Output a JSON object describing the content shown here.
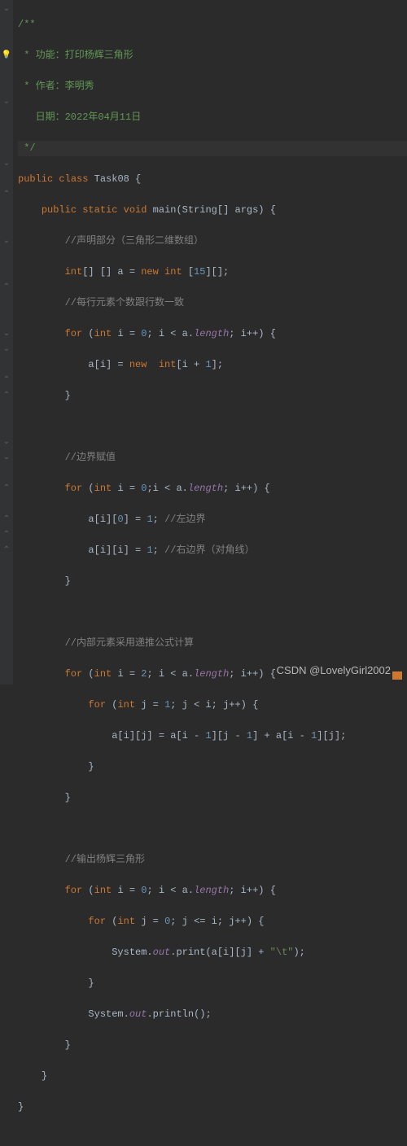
{
  "gutter": {
    "fold_down": "⌄",
    "fold_up": "⌃",
    "bulb": "💡",
    "close_brace": "⌃"
  },
  "code": {
    "l1": "/**",
    "l2_a": " * 功能：打印杨辉三角形",
    "l3_a": " * 作者：李明秀",
    "l4_a": "   日期：2022年04月11日",
    "l5": " */",
    "l6_kw1": "public",
    "l6_kw2": "class",
    "l6_name": " Task08 {",
    "l7_kw1": "public",
    "l7_kw2": "static",
    "l7_kw3": "void",
    "l7_name": " main(String[] args) {",
    "l8": "//声明部分（三角形二维数组）",
    "l9_kw1": "int",
    "l9_a": "[] [] a = ",
    "l9_kw2": "new int ",
    "l9_b": "[",
    "l9_n": "15",
    "l9_c": "][];",
    "l10": "//每行元素个数跟行数一致",
    "l11_kw1": "for ",
    "l11_a": "(",
    "l11_kw2": "int ",
    "l11_b": "i = ",
    "l11_n1": "0",
    "l11_c": "; i < a.",
    "l11_f": "length",
    "l11_d": "; i++) {",
    "l12_a": "a[i] = ",
    "l12_kw": "new  int",
    "l12_b": "[i + ",
    "l12_n": "1",
    "l12_c": "];",
    "l13": "}",
    "l15": "//边界赋值",
    "l16_kw1": "for ",
    "l16_a": "(",
    "l16_kw2": "int ",
    "l16_b": "i = ",
    "l16_n1": "0",
    "l16_c": ";i < a.",
    "l16_f": "length",
    "l16_d": "; i++) {",
    "l17_a": "a[i][",
    "l17_n1": "0",
    "l17_b": "] = ",
    "l17_n2": "1",
    "l17_c": "; ",
    "l17_cm": "//左边界",
    "l18_a": "a[i][i] = ",
    "l18_n": "1",
    "l18_b": "; ",
    "l18_cm": "//右边界（对角线）",
    "l19": "}",
    "l21": "//内部元素采用递推公式计算",
    "l22_kw1": "for ",
    "l22_a": "(",
    "l22_kw2": "int ",
    "l22_b": "i = ",
    "l22_n1": "2",
    "l22_c": "; i < a.",
    "l22_f": "length",
    "l22_d": "; i++) {",
    "l23_kw1": "for ",
    "l23_a": "(",
    "l23_kw2": "int ",
    "l23_b": "j = ",
    "l23_n1": "1",
    "l23_c": "; j < i; j++) {",
    "l24_a": "a[i][j] = a[i - ",
    "l24_n1": "1",
    "l24_b": "][j - ",
    "l24_n2": "1",
    "l24_c": "] + a[i - ",
    "l24_n3": "1",
    "l24_d": "][j];",
    "l25": "}",
    "l26": "}",
    "l28": "//输出杨辉三角形",
    "l29_kw1": "for ",
    "l29_a": "(",
    "l29_kw2": "int ",
    "l29_b": "i = ",
    "l29_n1": "0",
    "l29_c": "; i < a.",
    "l29_f": "length",
    "l29_d": "; i++) {",
    "l30_kw1": "for ",
    "l30_a": "(",
    "l30_kw2": "int ",
    "l30_b": "j = ",
    "l30_n1": "0",
    "l30_c": "; j <= i; j++) {",
    "l31_a": "System.",
    "l31_f": "out",
    "l31_b": ".print(a[i][j] + ",
    "l31_s": "\"\\t\"",
    "l31_c": ");",
    "l32": "}",
    "l33_a": "System.",
    "l33_f": "out",
    "l33_b": ".println();",
    "l34": "}",
    "l35": "}",
    "l36": "}"
  },
  "watermark": "CSDN @LovelyGirl2002"
}
